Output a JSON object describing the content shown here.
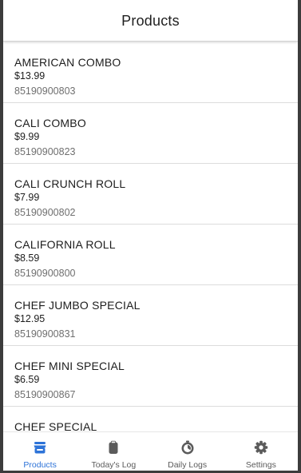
{
  "header": {
    "title": "Products"
  },
  "products": [
    {
      "name": "AMERICAN COMBO",
      "price": "$13.99",
      "code": "85190900803"
    },
    {
      "name": "CALI COMBO",
      "price": "$9.99",
      "code": "85190900823"
    },
    {
      "name": "CALI CRUNCH ROLL",
      "price": "$7.99",
      "code": "85190900802"
    },
    {
      "name": "CALIFORNIA ROLL",
      "price": "$8.59",
      "code": "85190900800"
    },
    {
      "name": "CHEF JUMBO SPECIAL",
      "price": "$12.95",
      "code": "85190900831"
    },
    {
      "name": "CHEF MINI SPECIAL",
      "price": "$6.59",
      "code": "85190900867"
    },
    {
      "name": "CHEF SPECIAL",
      "price": "",
      "code": ""
    }
  ],
  "bottom_nav": {
    "items": [
      {
        "label": "Products",
        "icon": "store-icon",
        "active": true
      },
      {
        "label": "Today's Log",
        "icon": "clipboard-icon",
        "active": false
      },
      {
        "label": "Daily Logs",
        "icon": "timer-icon",
        "active": false
      },
      {
        "label": "Settings",
        "icon": "gear-icon",
        "active": false
      }
    ]
  },
  "colors": {
    "accent": "#2d73d8",
    "icon_inactive": "#5b5b5b",
    "divider": "#dcdcdc",
    "frame_bg": "#3c3c3c"
  }
}
